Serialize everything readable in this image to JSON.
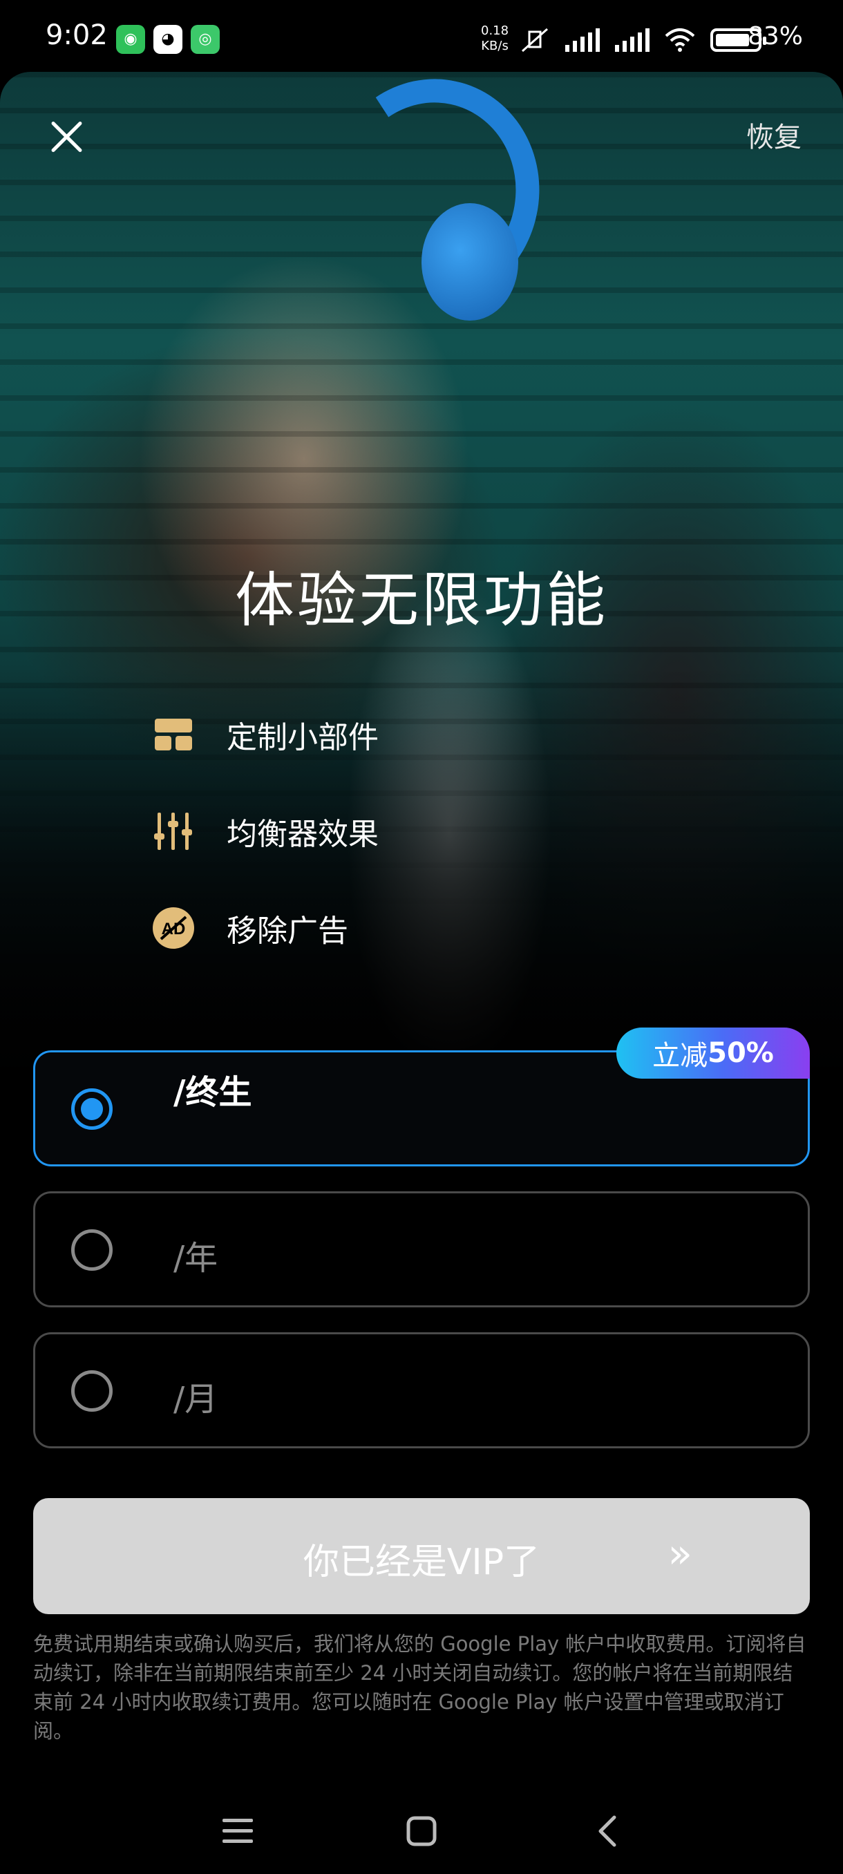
{
  "status_bar": {
    "time": "9:02",
    "apps": [
      "wechat-icon",
      "qq-icon",
      "app-icon"
    ],
    "speed_value": "0.18",
    "speed_unit": "KB/s",
    "battery_percent": "83%",
    "battery_level": 0.83
  },
  "header": {
    "restore_label": "恢复"
  },
  "hero": {
    "headline": "体验无限功能"
  },
  "features": [
    {
      "icon": "widget-icon",
      "label": "定制小部件"
    },
    {
      "icon": "equalizer-icon",
      "label": "均衡器效果"
    },
    {
      "icon": "no-ads-icon",
      "label": "移除广告"
    }
  ],
  "plans": [
    {
      "label": "/终生",
      "selected": true,
      "badge_prefix": "立减",
      "badge_value": "50%"
    },
    {
      "label": "/年",
      "selected": false
    },
    {
      "label": "/月",
      "selected": false
    }
  ],
  "cta": {
    "label": "你已经是VIP了",
    "arrow": "»"
  },
  "terms": "免费试用期结束或确认购买后，我们将从您的 Google Play 帐户中收取费用。订阅将自动续订，除非在当前期限结束前至少 24 小时关闭自动续订。您的帐户将在当前期限结束前 24 小时内收取续订费用。您可以随时在 Google Play 帐户设置中管理或取消订阅。",
  "colors": {
    "accent": "#2196f3",
    "feature_icon": "#e2bd7a",
    "badge_start": "#1fc1f2",
    "badge_end": "#8a3ff0",
    "cta_bg": "#d6d6d6"
  },
  "nav": [
    "menu-icon",
    "home-icon",
    "back-icon"
  ]
}
